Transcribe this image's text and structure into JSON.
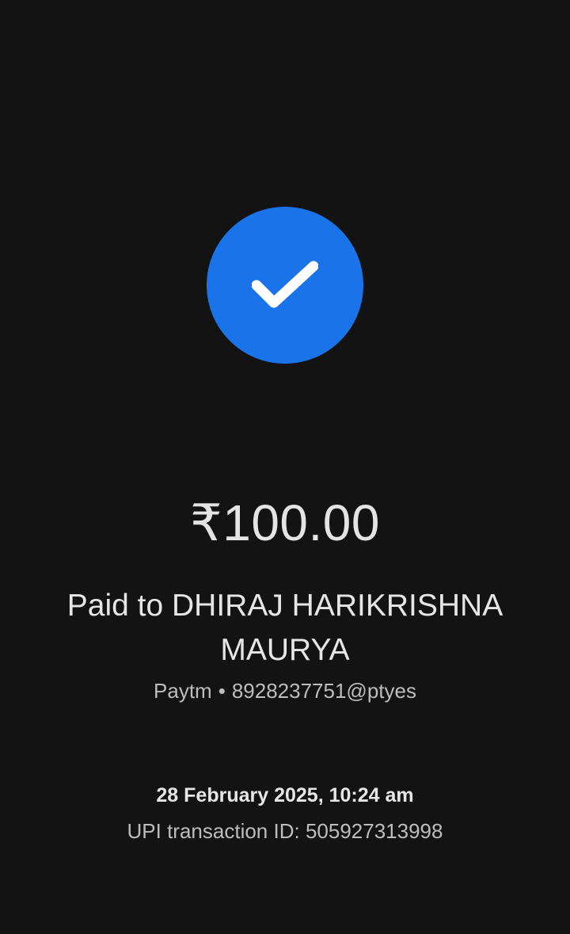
{
  "status": {
    "icon": "check-icon",
    "color": "#1a73e8"
  },
  "payment": {
    "amount": "₹100.00",
    "paid_to": "Paid to DHIRAJ HARIKRISHNA MAURYA",
    "app": "Paytm",
    "separator": "•",
    "upi_id": "8928237751@ptyes",
    "datetime": "28 February 2025, 10:24 am",
    "transaction_label": "UPI transaction ID:",
    "transaction_id": "505927313998"
  }
}
